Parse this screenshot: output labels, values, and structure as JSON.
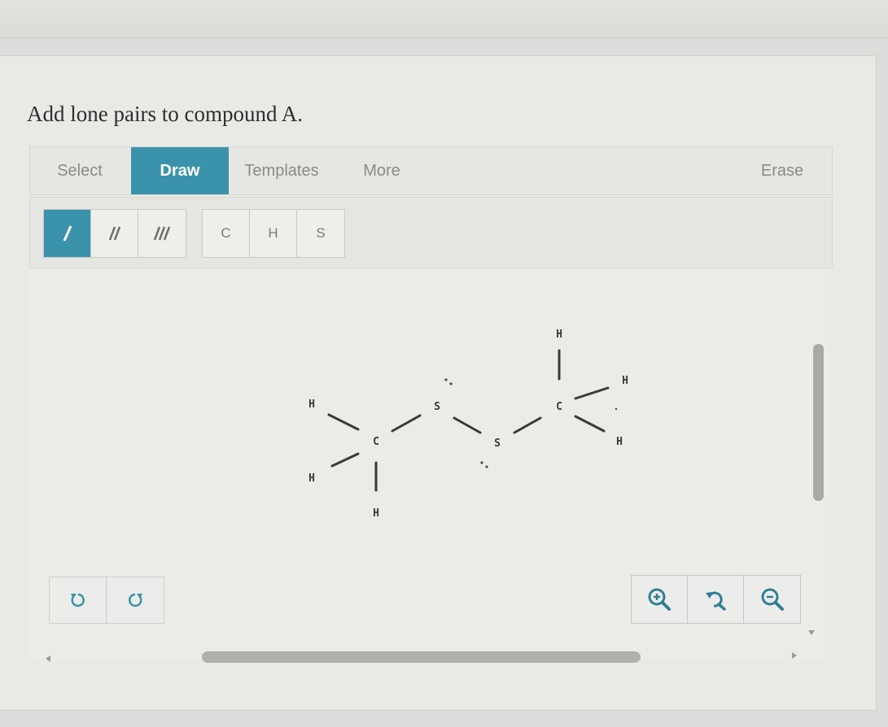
{
  "prompt": "Add lone pairs to compound A.",
  "tabs": [
    {
      "label": "Select",
      "active": false
    },
    {
      "label": "Draw",
      "active": true
    },
    {
      "label": "Templates",
      "active": false
    },
    {
      "label": "More",
      "active": false
    }
  ],
  "erase_label": "Erase",
  "bond_tools": [
    {
      "name": "single-bond-tool",
      "active": true
    },
    {
      "name": "double-bond-tool",
      "active": false
    },
    {
      "name": "triple-bond-tool",
      "active": false
    }
  ],
  "atom_tools": [
    "C",
    "H",
    "S"
  ],
  "molecule": {
    "atoms": [
      "H",
      "H",
      "C",
      "H",
      "S",
      "S",
      "C",
      "H",
      "H",
      "H"
    ]
  },
  "undo_icons": [
    "undo-icon",
    "redo-icon"
  ],
  "zoom_icons": [
    "zoom-in-icon",
    "reset-zoom-icon",
    "zoom-out-icon"
  ],
  "colors": {
    "accent": "#3a93aa",
    "background": "#e9e9e6",
    "atom_text": "#3a3a3a"
  }
}
